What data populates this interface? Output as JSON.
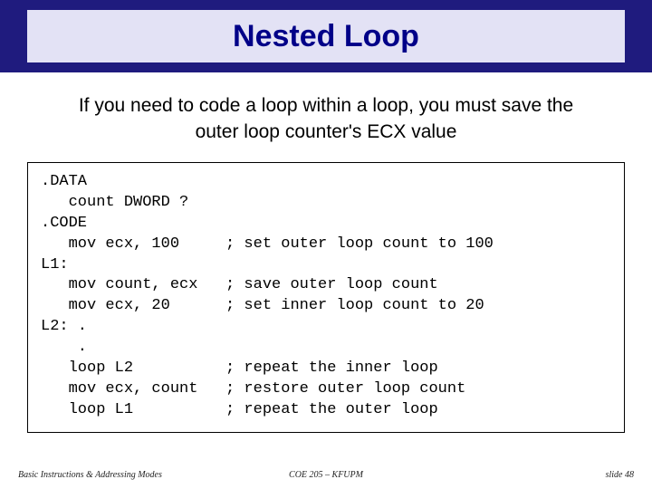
{
  "title": "Nested Loop",
  "intro": "If you need to code a loop within a loop, you must save the outer loop counter's ECX value",
  "code": ".DATA\n   count DWORD ?\n.CODE\n   mov ecx, 100     ; set outer loop count to 100\nL1:\n   mov count, ecx   ; save outer loop count\n   mov ecx, 20      ; set inner loop count to 20\nL2: .\n    .\n   loop L2          ; repeat the inner loop\n   mov ecx, count   ; restore outer loop count\n   loop L1          ; repeat the outer loop",
  "footer": {
    "left": "Basic Instructions & Addressing Modes",
    "center": "COE 205 – KFUPM",
    "right": "slide 48"
  }
}
